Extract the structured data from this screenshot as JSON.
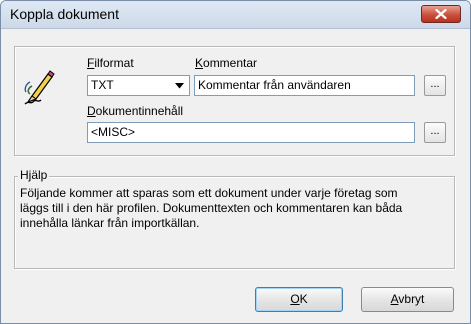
{
  "window": {
    "title": "Koppla dokument"
  },
  "form": {
    "fileformat_label_u": "F",
    "fileformat_label_rest": "ilformat",
    "fileformat_value": "TXT",
    "comment_label_u": "K",
    "comment_label_rest": "ommentar",
    "comment_value": "Kommentar från användaren",
    "comment_browse": "...",
    "content_label_u": "D",
    "content_label_rest": "okumentinnehåll",
    "content_value": "<MISC>",
    "content_browse": "..."
  },
  "help": {
    "legend": "Hjälp",
    "lines": [
      "Följande kommer att sparas som ett dokument under varje företag som",
      "läggs till i den här profilen. Dokumenttexten och kommentaren kan båda",
      "innehålla länkar från importkällan."
    ]
  },
  "buttons": {
    "ok_u": "O",
    "ok_rest": "K",
    "cancel_u": "A",
    "cancel_rest": "vbryt"
  },
  "colors": {
    "close_button": "#c9503c",
    "default_button_border": "#3c7fb1"
  }
}
